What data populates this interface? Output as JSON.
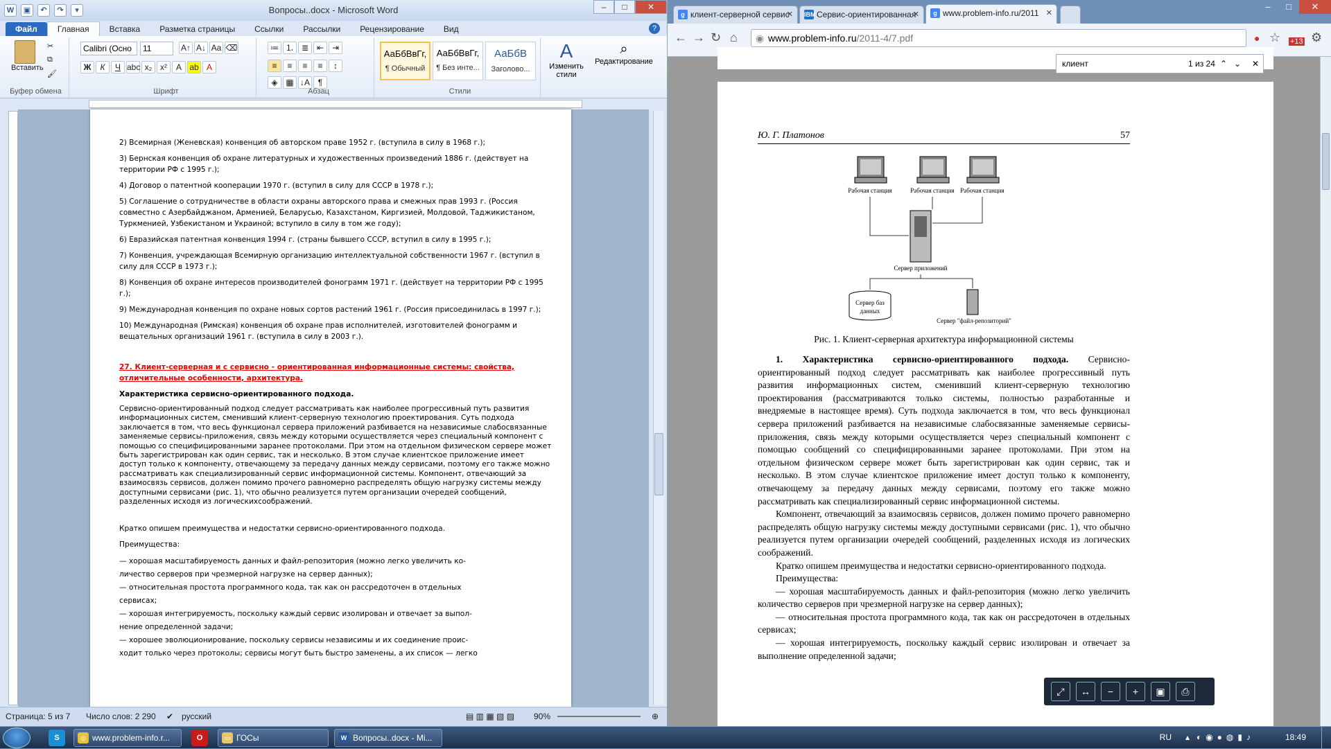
{
  "word": {
    "title": "Вопросы..docx - Microsoft Word",
    "qat_icons": [
      "word-logo-icon",
      "save-icon",
      "undo-icon",
      "redo-icon",
      "customize-icon"
    ],
    "tabs": {
      "file": "Файл",
      "home": "Главная",
      "insert": "Вставка",
      "layout": "Разметка страницы",
      "refs": "Ссылки",
      "mail": "Рассылки",
      "review": "Рецензирование",
      "view": "Вид"
    },
    "ribbon": {
      "paste": "Вставить",
      "clipboard": "Буфер обмена",
      "font_name": "Calibri (Осно",
      "font_size": "11",
      "font": "Шрифт",
      "paragraph": "Абзац",
      "styles": [
        {
          "sample": "АаБбВвГг,",
          "name": "¶ Обычный"
        },
        {
          "sample": "АаБбВвГг,",
          "name": "¶ Без инте..."
        },
        {
          "sample": "АаБбВ",
          "name": "Заголово..."
        }
      ],
      "styles_group": "Стили",
      "change_styles": "Изменить стили",
      "editing": "Редактирование"
    },
    "doc": {
      "items": [
        "2) Всемирная (Женевская) конвенция об авторском праве 1952 г. (вступила в силу в 1968 г.);",
        "3) Бернская конвенция об охране литературных и художественных произведений 1886 г. (действует на территории РФ с 1995 г.);",
        "4) Договор о патентной кооперации 1970 г. (вступил в силу для СССР в 1978 г.);",
        "5) Соглашение о сотрудничестве в области охраны авторского права и смежных прав 1993 г. (Россия совместно с Азербайджаном, Арменией, Беларусью, Казахстаном, Киргизией, Молдовой, Таджикистаном, Туркменией, Узбекистаном и Украиной; вступило в силу в том же году);",
        "6) Евразийская патентная конвенция 1994 г. (страны бывшего СССР, вступил в силу в 1995 г.);",
        "7) Конвенция, учреждающая Всемирную организацию интеллектуальной собственности 1967 г. (вступил в силу для СССР в 1973 г.);",
        "8) Конвенция об охране интересов производителей фонограмм 1971 г. (действует на территории РФ с 1995 г.);",
        "9) Международная конвенция по охране новых сортов растений 1961 г. (Россия присоединилась в 1997 г.);",
        "10) Международная (Римская) конвенция об охране прав исполнителей, изготовителей фонограмм и вещательных организаций 1961 г. (вступила в силу в 2003 г.)."
      ],
      "heading": "27. Клиент-серверная и с сервисно - ориентированная информационные системы: свойства, отличительные особенности, архитектура.",
      "subheading": "Характеристика сервисно-ориентированного подхода.",
      "para": "Сервисно-ориентированный подход следует рассматривать как наиболее прогрессивный путь развития информационных систем, сменивший клиент-серверную технологию проектирования. Суть подхода заключается в том, что весь функционал сервера приложений разбивается на независимые слабосвязанные заменяемые сервисы-приложения, связь между которыми осуществляется через специальный компонент с помощью со специфицированными заранее протоколами. При этом на отдельном физическом сервере может быть зарегистрирован как один сервис, так и несколько. В этом случае клиентское приложение имеет доступ только к компоненту, отвечающему за передачу данных между сервисами, поэтому его также можно рассматривать как специализированный сервис информационной системы. Компонент, отвечающий за взаимосвязь сервисов, должен помимо прочего равномерно распределять общую нагрузку системы между доступными сервисами (рис. 1), что обычно реализуется путем организации очередей сообщений, разделенных исходя из логическихсоображений.",
      "brief": "Кратко опишем преимущества и недостатки сервисно-ориентированного подхода.",
      "adv": "Преимущества:",
      "adv_items": [
        "— хорошая масштабируемость данных и файл-репозитория (можно легко увеличить ко-",
        "личество серверов при чрезмерной нагрузке на сервер данных);",
        "— относительная простота программного кода, так как он рассредоточен в отдельных",
        "сервисах;",
        "— хорошая интегрируемость, поскольку каждый сервис изолирован и отвечает за выпол-",
        "нение определенной задачи;",
        "— хорошее эволюционирование, поскольку сервисы независимы и их соединение проис-",
        "ходит только через протоколы; сервисы могут быть быстро заменены, а их список — легко"
      ]
    },
    "status": {
      "page": "Страница: 5 из 7",
      "words": "Число слов: 2 290",
      "lang": "русский",
      "zoom": "90%"
    }
  },
  "chrome": {
    "tabs": [
      {
        "title": "клиент-серверной сервис",
        "icon": "google-icon"
      },
      {
        "title": "Сервис-ориентированная",
        "icon": "ibm-icon",
        "badge": "IBM"
      },
      {
        "title": "www.problem-info.ru/2011",
        "icon": "google-icon"
      }
    ],
    "url_host": "www.problem-info.ru",
    "url_path": "/2011-4/7.pdf",
    "find": {
      "query": "клиент",
      "count": "1 из 24"
    },
    "ext_badge": "+13",
    "pdf": {
      "author": "Ю. Г. Платонов",
      "page_no": "57",
      "diagram": {
        "ws": [
          "Рабочая станция",
          "Рабочая станция",
          "Рабочая станция"
        ],
        "app": "Сервер приложений",
        "db1": "Сервер баз",
        "db2": "данных",
        "repo": "Сервер \"файл-репозиторий\""
      },
      "caption": "Рис. 1. Клиент-серверная архитектура информационной системы",
      "h1": "1. Характеристика сервисно-ориентированного подхода.",
      "p1": "Сервисно-ориентированный подход следует рассматривать как наиболее прогрессивный путь развития информационных систем, сменивший клиент-серверную технологию проектирования (рассматриваются только системы, полностью разработанные и внедряемые в настоящее время). Суть подхода заключается в том, что весь функционал сервера приложений разбивается на независимые слабосвязанные заменяемые сервисы-приложения, связь между которыми осуществляется через специальный компонент с помощью сообщений со специфицированными заранее протоколами. При этом на отдельном физическом сервере может быть зарегистрирован как один сервис, так и несколько. В этом случае клиентское приложение имеет доступ только к компоненту, отвечающему за передачу данных между сервисами, поэтому его также можно рассматривать как специализированный сервис информационной системы.",
      "p2": "Компонент, отвечающий за взаимосвязь сервисов, должен помимо прочего равномерно распределять общую нагрузку системы между доступными сервисами (рис. 1), что обычно реализуется путем организации очередей сообщений, разделенных исходя из логических соображений.",
      "p3": "Кратко опишем преимущества и недостатки сервисно-ориентированного подхода.",
      "p4": "Преимущества:",
      "p5": "— хорошая масштабируемость данных и файл-репозитория (можно легко увеличить количество серверов при чрезмерной нагрузке на сервер данных);",
      "p6": "— относительная простота программного кода, так как он рассредоточен в отдельных сервисах;",
      "p7": "— хорошая интегрируемость, поскольку каждый сервис изолирован и отвечает за выполнение определенной задачи;"
    }
  },
  "taskbar": {
    "items": [
      "www.problem-info.r...",
      "ГОСы",
      "Вопросы..docx - Mi..."
    ],
    "lang": "RU",
    "time": "18:49"
  }
}
